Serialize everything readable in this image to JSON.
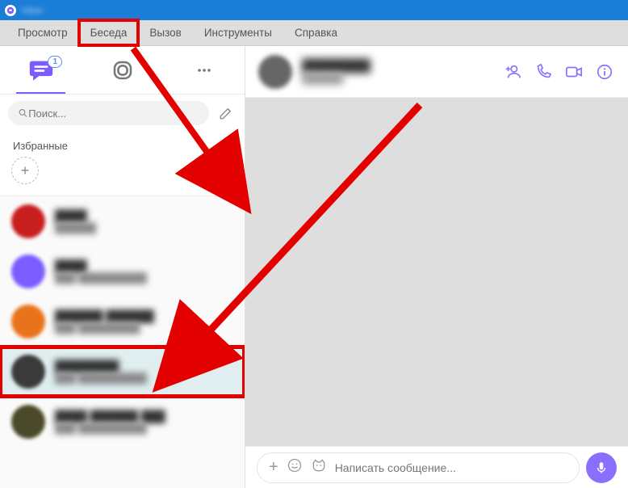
{
  "window": {
    "title": "Viber"
  },
  "menu": {
    "view": "Просмотр",
    "chat": "Беседа",
    "call": "Вызов",
    "tools": "Инструменты",
    "help": "Справка"
  },
  "sidebar": {
    "tabs": {
      "badge": "1"
    },
    "search": {
      "placeholder": "Поиск..."
    },
    "favorites": {
      "title": "Избранные"
    },
    "chats": [
      {
        "name": "████",
        "sub": "██████",
        "avatar_color": "#c81e1e"
      },
      {
        "name": "████",
        "sub": "███ ██████████",
        "avatar_color": "#7c5cff"
      },
      {
        "name": "██████ ██████",
        "sub": "███ █████████",
        "avatar_color": "#e9731a"
      },
      {
        "name": "████████",
        "sub": "███ ██████████",
        "avatar_color": "#3a3a3a"
      },
      {
        "name": "████ ██████ ███",
        "sub": "███ ██████████",
        "avatar_color": "#4a4a2a"
      }
    ]
  },
  "chat": {
    "header": {
      "name": "████████",
      "sub": "██████"
    },
    "composer": {
      "plus": "+",
      "placeholder": "Написать сообщение..."
    }
  }
}
